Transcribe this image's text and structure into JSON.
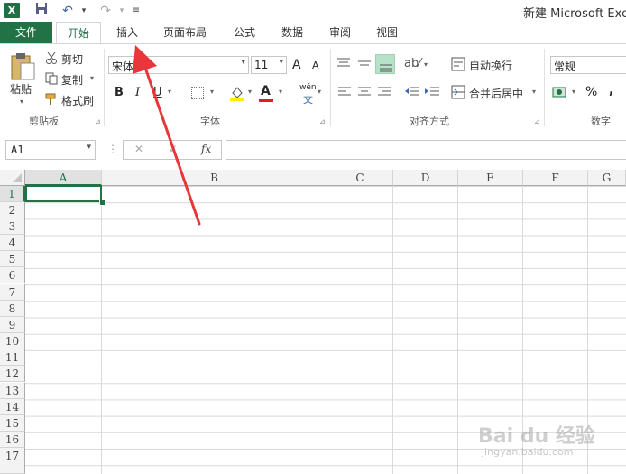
{
  "window": {
    "title": "新建 Microsoft Exce"
  },
  "qat": {
    "logo": "X"
  },
  "tabs": [
    {
      "label": "文件"
    },
    {
      "label": "开始"
    },
    {
      "label": "插入"
    },
    {
      "label": "页面布局"
    },
    {
      "label": "公式"
    },
    {
      "label": "数据"
    },
    {
      "label": "审阅"
    },
    {
      "label": "视图"
    }
  ],
  "clipboard": {
    "paste": "粘贴",
    "cut": "剪切",
    "copy": "复制",
    "format_painter": "格式刷",
    "group": "剪贴板"
  },
  "font": {
    "name": "宋体",
    "size": "11",
    "grow": "A",
    "shrink": "A",
    "bold": "B",
    "italic": "I",
    "underline": "U",
    "color_a": "A",
    "phonetic": "wén",
    "group": "字体"
  },
  "alignment": {
    "wrap": "自动换行",
    "merge": "合并后居中",
    "group": "对齐方式"
  },
  "number": {
    "format": "常规",
    "percent": "%",
    "comma": ",",
    "group": "数字"
  },
  "formula_bar": {
    "name_box": "A1",
    "fx": "fx",
    "cancel": "✕",
    "enter": "✓"
  },
  "columns": [
    "A",
    "B",
    "C",
    "D",
    "E",
    "F",
    "G"
  ],
  "rows": [
    "1",
    "2",
    "3",
    "4",
    "5",
    "6",
    "7",
    "8",
    "9",
    "10",
    "11",
    "12",
    "13",
    "14",
    "15",
    "16",
    "17"
  ],
  "colors": {
    "accent": "#217346",
    "arrow": "#e8363a"
  },
  "watermark": {
    "brand": "Bai du 经验",
    "url": "jingyan.baidu.com"
  }
}
